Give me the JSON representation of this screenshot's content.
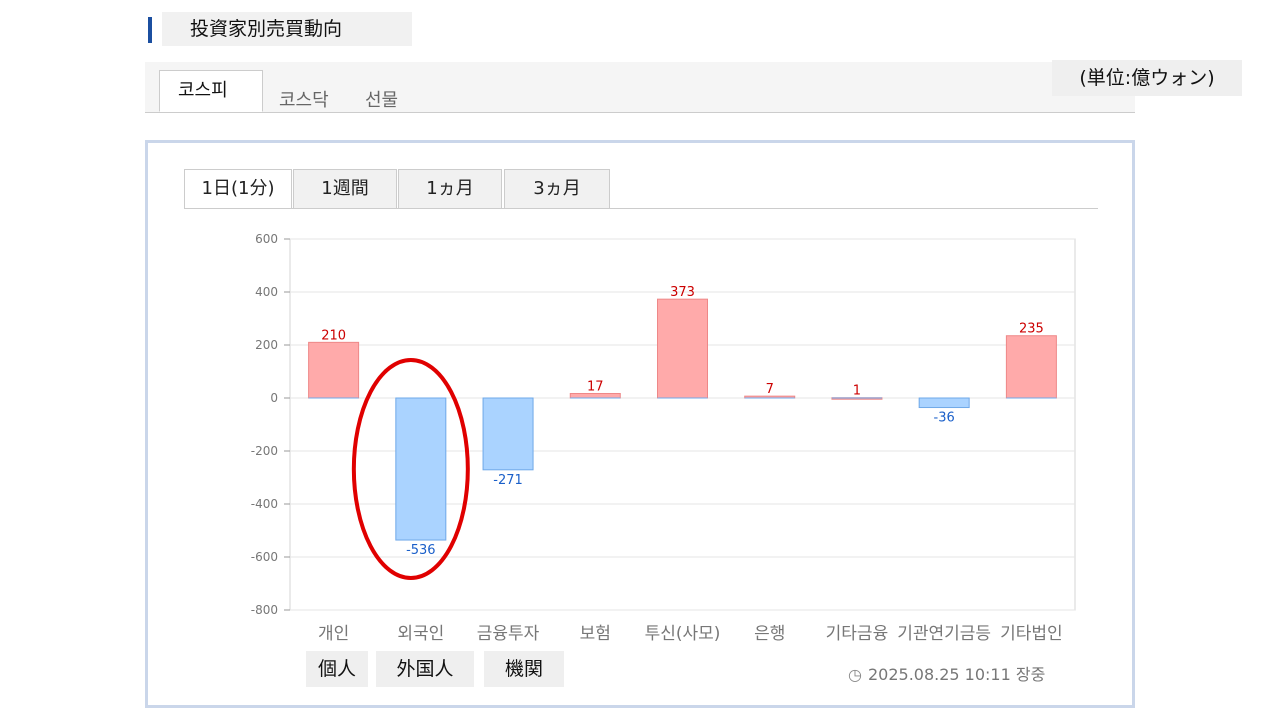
{
  "header": {
    "title": "投資家別売買動向",
    "accent_color": "#1b4fa0"
  },
  "market_tabs": [
    "코스피",
    "코스닥",
    "선물"
  ],
  "unit_label": "(単位:億ウォン)",
  "period_tabs": [
    "1日(1分)",
    "1週間",
    "1ヵ月",
    "3ヵ月"
  ],
  "chart_data": {
    "type": "bar",
    "categories": [
      "개인",
      "외국인",
      "금융투자",
      "보험",
      "투신(사모)",
      "은행",
      "기타금융",
      "기관연기금등",
      "기타법인"
    ],
    "values": [
      210,
      -536,
      -271,
      17,
      373,
      7,
      1,
      -36,
      235
    ],
    "ylim": [
      -800,
      600
    ],
    "yticks": [
      600,
      400,
      200,
      0,
      -200,
      -400,
      -600,
      -800
    ],
    "grid": true,
    "colors": {
      "positive_fill": "#ffaaaa",
      "positive_stroke": "#ee8888",
      "positive_label": "#cc0000",
      "negative_fill": "#aad3ff",
      "negative_stroke": "#6fa8e8",
      "negative_label": "#1a5fc9"
    },
    "highlight": {
      "category": "외국인",
      "color": "#e00000"
    }
  },
  "annotations": [
    "個人",
    "外国人",
    "機関"
  ],
  "timestamp": "2025.08.25 10:11 장중",
  "clock_icon": "clock-icon"
}
